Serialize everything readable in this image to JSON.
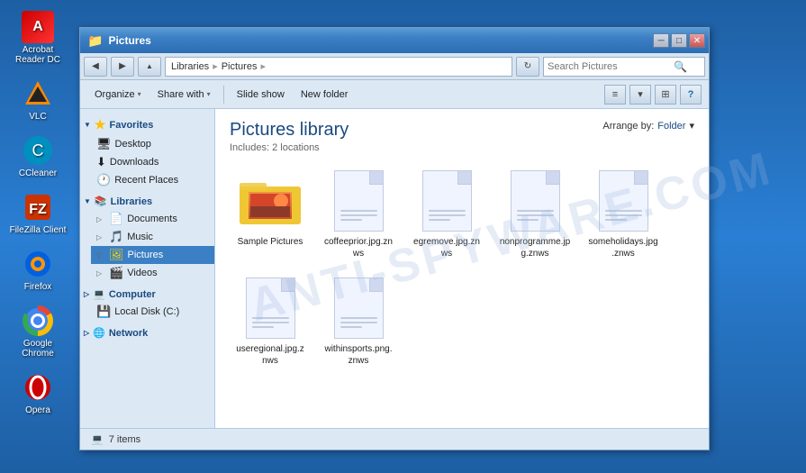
{
  "desktop": {
    "icons": [
      {
        "id": "acrobat",
        "label": "Acrobat\nReader DC",
        "symbol": "A"
      },
      {
        "id": "vlc",
        "label": "VLC",
        "symbol": "▶"
      },
      {
        "id": "ccleaner",
        "label": "CCleaner",
        "symbol": "C"
      },
      {
        "id": "filezilla",
        "label": "FileZilla Client",
        "symbol": "F"
      },
      {
        "id": "firefox",
        "label": "Firefox",
        "symbol": "🦊"
      },
      {
        "id": "chrome",
        "label": "Google Chrome",
        "symbol": "●"
      },
      {
        "id": "opera",
        "label": "Opera",
        "symbol": "O"
      }
    ]
  },
  "window": {
    "title": "Pictures",
    "title_icon": "📁"
  },
  "address_bar": {
    "back_btn": "◀",
    "forward_btn": "▶",
    "up_btn": "▲",
    "path": "Libraries ▸ Pictures",
    "libraries_label": "Libraries",
    "pictures_label": "Pictures",
    "search_placeholder": "Search Pictures"
  },
  "toolbar": {
    "organize_label": "Organize",
    "share_with_label": "Share with",
    "slide_show_label": "Slide show",
    "new_folder_label": "New folder"
  },
  "nav_pane": {
    "favorites_label": "Favorites",
    "favorites_items": [
      {
        "id": "desktop",
        "label": "Desktop"
      },
      {
        "id": "downloads",
        "label": "Downloads"
      },
      {
        "id": "recent_places",
        "label": "Recent Places"
      }
    ],
    "libraries_label": "Libraries",
    "library_items": [
      {
        "id": "documents",
        "label": "Documents"
      },
      {
        "id": "music",
        "label": "Music"
      },
      {
        "id": "pictures",
        "label": "Pictures",
        "selected": true
      },
      {
        "id": "videos",
        "label": "Videos"
      }
    ],
    "computer_label": "Computer",
    "computer_items": [
      {
        "id": "local_disk",
        "label": "Local Disk (C:)"
      }
    ],
    "network_label": "Network"
  },
  "content": {
    "library_title": "Pictures library",
    "includes_label": "Includes:",
    "locations_count": "2 locations",
    "arrange_by_label": "Arrange by:",
    "arrange_by_value": "Folder",
    "files": [
      {
        "id": "sample_pictures",
        "label": "Sample Pictures",
        "type": "folder"
      },
      {
        "id": "coffeeprior",
        "label": "coffeeprior.jpg.znws",
        "type": "doc"
      },
      {
        "id": "egremove",
        "label": "egremove.jpg.znws",
        "type": "doc"
      },
      {
        "id": "nonprogramme",
        "label": "nonprogramme.jpg.znws",
        "type": "doc"
      },
      {
        "id": "someholidays",
        "label": "someholidays.jpg.znws",
        "type": "doc"
      },
      {
        "id": "useregional",
        "label": "useregional.jpg.znws",
        "type": "doc"
      },
      {
        "id": "withinsports",
        "label": "withinsports.png.znws",
        "type": "doc"
      }
    ]
  },
  "status_bar": {
    "item_count": "7 items",
    "computer_icon": "💻"
  }
}
